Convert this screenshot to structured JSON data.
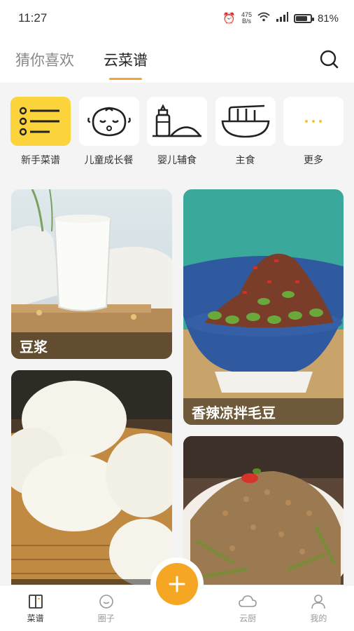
{
  "status_bar": {
    "time": "11:27",
    "speed": "475\nB/s",
    "battery": "81%",
    "battery_level": 0.81
  },
  "top_tabs": [
    {
      "label": "猜你喜欢",
      "active": false
    },
    {
      "label": "云菜谱",
      "active": true
    }
  ],
  "categories": [
    {
      "label": "新手菜谱",
      "icon": "list-icon"
    },
    {
      "label": "儿童成长餐",
      "icon": "baby-face-icon"
    },
    {
      "label": "婴儿辅食",
      "icon": "baby-bottle-icon"
    },
    {
      "label": "主食",
      "icon": "noodle-bowl-icon"
    },
    {
      "label": "更多",
      "icon": "more-dots-icon"
    }
  ],
  "recipes": [
    {
      "title": "豆浆"
    },
    {
      "title": "香辣凉拌毛豆"
    },
    {
      "title": ""
    },
    {
      "title": ""
    }
  ],
  "bottom_nav": [
    {
      "label": "菜谱",
      "icon": "book-icon",
      "active": true
    },
    {
      "label": "圈子",
      "icon": "chat-icon",
      "active": false
    },
    {
      "label": "云厨",
      "icon": "cloud-icon",
      "active": false
    },
    {
      "label": "我的",
      "icon": "user-icon",
      "active": false
    }
  ],
  "colors": {
    "accent": "#f5a623",
    "category_highlight": "#fbd33a"
  }
}
